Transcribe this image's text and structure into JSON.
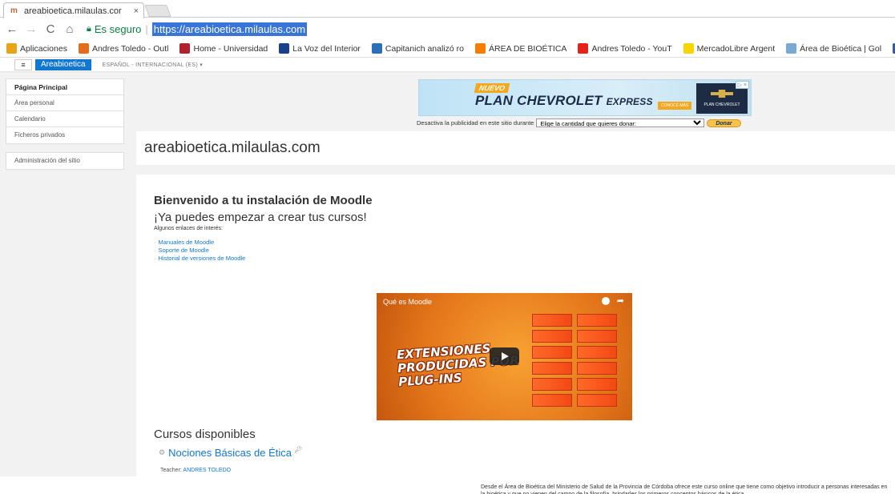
{
  "browser": {
    "tab_title": "areabioetica.milaulas.cor",
    "tab_close": "×",
    "secure_label": "Es seguro",
    "url": "https://areabioetica.milaulas.com",
    "bookmarks": [
      {
        "label": "Aplicaciones",
        "icon": "apps-grid-icon",
        "color": "#e8a317"
      },
      {
        "label": "Andres Toledo - Outl",
        "icon": "outlook-icon",
        "color": "#e56d1a"
      },
      {
        "label": "Home - Universidad",
        "icon": "university-icon",
        "color": "#b21f2d"
      },
      {
        "label": "La Voz del Interior",
        "icon": "lavoz-icon",
        "color": "#1a3f8c"
      },
      {
        "label": "Capitanich analizó ro",
        "icon": "news-icon",
        "color": "#2a6fb8"
      },
      {
        "label": "ÁREA DE BIOÉTICA",
        "icon": "blogger-icon",
        "color": "#f57d00"
      },
      {
        "label": "Andres Toledo - YouT",
        "icon": "youtube-icon",
        "color": "#e62117"
      },
      {
        "label": "MercadoLibre Argent",
        "icon": "mercadolibre-icon",
        "color": "#f7d600"
      },
      {
        "label": "Área de Bioética | Gol",
        "icon": "site-icon",
        "color": "#7aa9d6"
      },
      {
        "label": "Fa",
        "icon": "facebook-icon",
        "color": "#3b5998"
      }
    ]
  },
  "moodle": {
    "menu_icon": "≡",
    "brand": "Areabioetica",
    "language": "ESPAÑOL - INTERNACIONAL (ES) ▾",
    "drawer": {
      "group1": [
        "Página Principal",
        "Área personal",
        "Calendario",
        "Ficheros privados"
      ],
      "group2": [
        "Administración del sitio"
      ]
    },
    "ad": {
      "badge": "NUEVO",
      "headline_main": "PLAN CHEVROLET",
      "headline_small": "EXPRESS",
      "cta": "CONOCÉ MÁS",
      "logo_text": "PLAN CHEVROLET",
      "close": "▷ ×"
    },
    "donate": {
      "text": "Desactiva la publicidad en este sitio durante",
      "select_value": "Elige la cantidad que quieres donar:",
      "button": "Donar"
    },
    "site_title": "areabioetica.milaulas.com",
    "welcome": "Bienvenido a tu instalación de Moodle",
    "start": "¡Ya puedes empezar a crear tus cursos!",
    "intro": "Algunos enlaces de interés:",
    "links": [
      "Manuales de Moodle",
      "Soporte de Moodle",
      "Historial de versiones de Moodle"
    ],
    "video": {
      "title": "Qué es Moodle",
      "overlay_lines": [
        "EXTENSIONES",
        "PRODUCIDAS POR",
        "PLUG-INS"
      ]
    },
    "courses_heading": "Cursos disponibles",
    "course": {
      "name": "Nociones Básicas de Ética",
      "teacher_label": "Teacher:",
      "teacher_name": "ANDRES TOLEDO",
      "summary": "Desde el Área de Bioética del Ministerio de Salud de la Provincia de Córdoba ofrece este curso online que tiene como objetivo introducir a personas interesadas en la bioética y que no vienen del campo de la filosofía, brindarles los primeros conceptos básicos de la ética."
    }
  }
}
